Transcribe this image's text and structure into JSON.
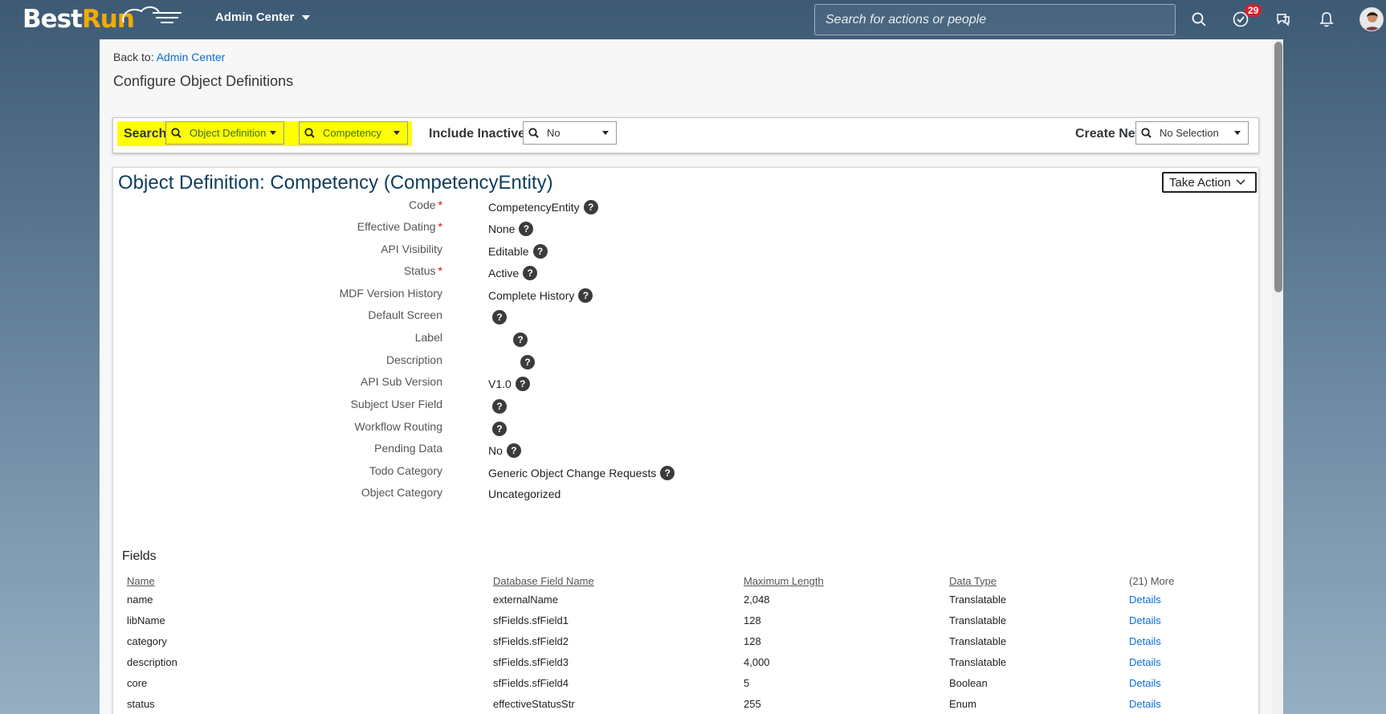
{
  "shell": {
    "logo_best": "Best",
    "logo_run": "Run",
    "module_menu": "Admin Center",
    "search_placeholder": "Search for actions or people",
    "todo_count": "29",
    "icons": [
      "search-icon",
      "todo-check-icon",
      "feedback-icon",
      "bell-icon",
      "avatar"
    ]
  },
  "page": {
    "back_to_prefix": "Back to:",
    "back_to_link": "Admin Center",
    "title": "Configure Object Definitions"
  },
  "searchbar": {
    "search_label": "Search",
    "type_value": "Object Definition",
    "object_value": "Competency",
    "include_inactives_label": "Include Inactives:",
    "include_inactives_value": "No",
    "create_new_label": "Create New",
    "create_new_value": "No Selection"
  },
  "object": {
    "title": "Object Definition: Competency (CompetencyEntity)",
    "take_action": "Take Action",
    "properties": [
      {
        "label": "Code",
        "required": true,
        "value": "CompetencyEntity"
      },
      {
        "label": "Effective Dating",
        "required": true,
        "value": "None"
      },
      {
        "label": "API Visibility",
        "required": false,
        "value": "Editable"
      },
      {
        "label": "Status",
        "required": true,
        "value": "Active"
      },
      {
        "label": "MDF Version History",
        "required": false,
        "value": "Complete History"
      },
      {
        "label": "Default Screen",
        "required": false,
        "value": ""
      },
      {
        "label": "Label",
        "required": false,
        "value": ""
      },
      {
        "label": "Description",
        "required": false,
        "value": ""
      },
      {
        "label": "API Sub Version",
        "required": false,
        "value": "V1.0"
      },
      {
        "label": "Subject User Field",
        "required": false,
        "value": ""
      },
      {
        "label": "Workflow Routing",
        "required": false,
        "value": ""
      },
      {
        "label": "Pending Data",
        "required": false,
        "value": "No"
      },
      {
        "label": "Todo Category",
        "required": false,
        "value": "Generic Object Change Requests"
      },
      {
        "label": "Object Category",
        "required": false,
        "value": "Uncategorized"
      }
    ]
  },
  "fields": {
    "title": "Fields",
    "columns": [
      "Name",
      "Database Field Name",
      "Maximum Length",
      "Data Type",
      "(21) More"
    ],
    "rows": [
      [
        "name",
        "externalName",
        "2,048",
        "Translatable",
        "Details"
      ],
      [
        "libName",
        "sfFields.sfField1",
        "128",
        "Translatable",
        "Details"
      ],
      [
        "category",
        "sfFields.sfField2",
        "128",
        "Translatable",
        "Details"
      ],
      [
        "description",
        "sfFields.sfField3",
        "4,000",
        "Translatable",
        "Details"
      ],
      [
        "core",
        "sfFields.sfField4",
        "5",
        "Boolean",
        "Details"
      ],
      [
        "status",
        "effectiveStatusStr",
        "255",
        "Enum",
        "Details"
      ]
    ]
  },
  "colors": {
    "highlight": "#ffff00",
    "link": "#0a6ed1",
    "badge": "#d32030",
    "title": "#0f3d5a"
  }
}
